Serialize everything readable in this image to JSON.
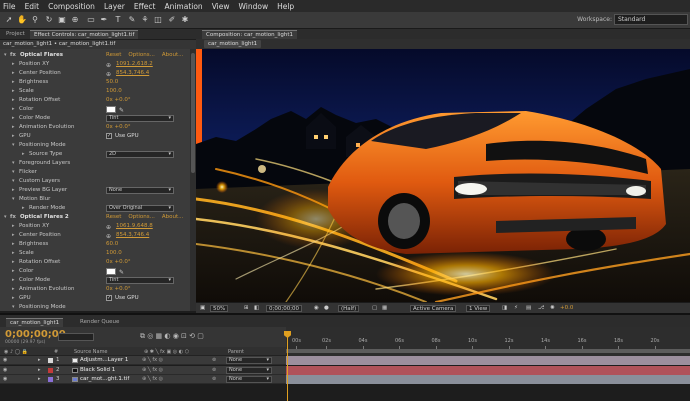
{
  "menu": [
    "File",
    "Edit",
    "Composition",
    "Layer",
    "Effect",
    "Animation",
    "View",
    "Window",
    "Help"
  ],
  "toolbar": {
    "icons": [
      "selection-tool-icon",
      "hand-tool-icon",
      "zoom-tool-icon",
      "rotate-tool-icon",
      "camera-tool-icon",
      "pan-behind-icon",
      "mask-tool-icon",
      "pen-tool-icon",
      "text-tool-icon",
      "brush-tool-icon",
      "clone-stamp-icon",
      "eraser-icon",
      "roto-brush-icon",
      "puppet-pin-icon"
    ],
    "workspace_label": "Workspace:",
    "workspace_value": "Standard"
  },
  "left_tabs": {
    "project": "Project",
    "effect_controls": "Effect Controls: car_motion_light1.tif"
  },
  "effect_controls": {
    "subtitle": "car_motion_light1 • car_motion_light1.tif",
    "reset": "Reset",
    "options": "Options...",
    "about": "About...",
    "rows": [
      {
        "kind": "hdr",
        "label": "Optical Flares",
        "indent": 0
      },
      {
        "kind": "point",
        "label": "Position XY",
        "value": "1091.2,618.2",
        "indent": 1
      },
      {
        "kind": "point",
        "label": "Center Position",
        "value": "854.3,746.4",
        "indent": 1
      },
      {
        "kind": "num",
        "label": "Brightness",
        "value": "50.0",
        "indent": 1
      },
      {
        "kind": "num",
        "label": "Scale",
        "value": "100.0",
        "indent": 1
      },
      {
        "kind": "num",
        "label": "Rotation Offset",
        "value": "0x +0.0°",
        "indent": 1
      },
      {
        "kind": "color",
        "label": "Color",
        "indent": 1
      },
      {
        "kind": "dd",
        "label": "Color Mode",
        "value": "Tint",
        "indent": 1
      },
      {
        "kind": "num",
        "label": "Animation Evolution",
        "value": "0x +0.0°",
        "indent": 1
      },
      {
        "kind": "chk",
        "label": "GPU",
        "value": "Use GPU",
        "indent": 1
      },
      {
        "kind": "grp",
        "label": "Positioning Mode",
        "indent": 1
      },
      {
        "kind": "dd",
        "label": "Source Type",
        "value": "2D",
        "indent": 2
      },
      {
        "kind": "grp",
        "label": "Foreground Layers",
        "indent": 1
      },
      {
        "kind": "grp",
        "label": "Flicker",
        "indent": 1
      },
      {
        "kind": "grp",
        "label": "Custom Layers",
        "indent": 1
      },
      {
        "kind": "dd",
        "label": "Preview BG Layer",
        "value": "None",
        "indent": 1
      },
      {
        "kind": "grp",
        "label": "Motion Blur",
        "indent": 1
      },
      {
        "kind": "dd",
        "label": "Render Mode",
        "value": "Over Original",
        "indent": 2
      },
      {
        "kind": "hdr",
        "label": "Optical Flares 2",
        "indent": 0
      },
      {
        "kind": "point",
        "label": "Position XY",
        "value": "1061.9,648.8",
        "indent": 1
      },
      {
        "kind": "point",
        "label": "Center Position",
        "value": "854.3,746.4",
        "indent": 1
      },
      {
        "kind": "num",
        "label": "Brightness",
        "value": "60.0",
        "indent": 1
      },
      {
        "kind": "num",
        "label": "Scale",
        "value": "100.0",
        "indent": 1
      },
      {
        "kind": "num",
        "label": "Rotation Offset",
        "value": "0x +0.0°",
        "indent": 1
      },
      {
        "kind": "color",
        "label": "Color",
        "indent": 1
      },
      {
        "kind": "dd",
        "label": "Color Mode",
        "value": "Tint",
        "indent": 1
      },
      {
        "kind": "num",
        "label": "Animation Evolution",
        "value": "0x +0.0°",
        "indent": 1
      },
      {
        "kind": "chk",
        "label": "GPU",
        "value": "Use GPU",
        "indent": 1
      },
      {
        "kind": "grp",
        "label": "Positioning Mode",
        "indent": 1
      }
    ]
  },
  "composition": {
    "tab": "Composition: car_motion_light1",
    "chip": "car_motion_light1",
    "footer": {
      "zoom": "50%",
      "timecode": "0;00;00;00",
      "resolution": "(Half)",
      "camera": "Active Camera",
      "views": "1 View",
      "exposure": "+0.0"
    }
  },
  "timeline": {
    "tab": "car_motion_light1",
    "render_queue": "Render Queue",
    "timecode": "0;00;00;00",
    "fps": "00000 (29.97 fps)",
    "headers": {
      "source": "Source Name",
      "parent": "Parent"
    },
    "ticks": [
      "00s",
      "02s",
      "04s",
      "06s",
      "08s",
      "10s",
      "12s",
      "14s",
      "16s",
      "18s",
      "20s"
    ],
    "layers": [
      {
        "num": "1",
        "name": "Adjustm...Layer 1",
        "label_color": "#d8d8d8",
        "bar_color": "#9c8f9e",
        "parent": "None"
      },
      {
        "num": "2",
        "name": "Black Solid 1",
        "label_color": "#c23a3a",
        "bar_color": "#b0525a",
        "parent": "None"
      },
      {
        "num": "3",
        "name": "car_mot...ght.1.tif",
        "label_color": "#8a6fd6",
        "bar_color": "#8a8f9a",
        "parent": "None"
      }
    ]
  }
}
